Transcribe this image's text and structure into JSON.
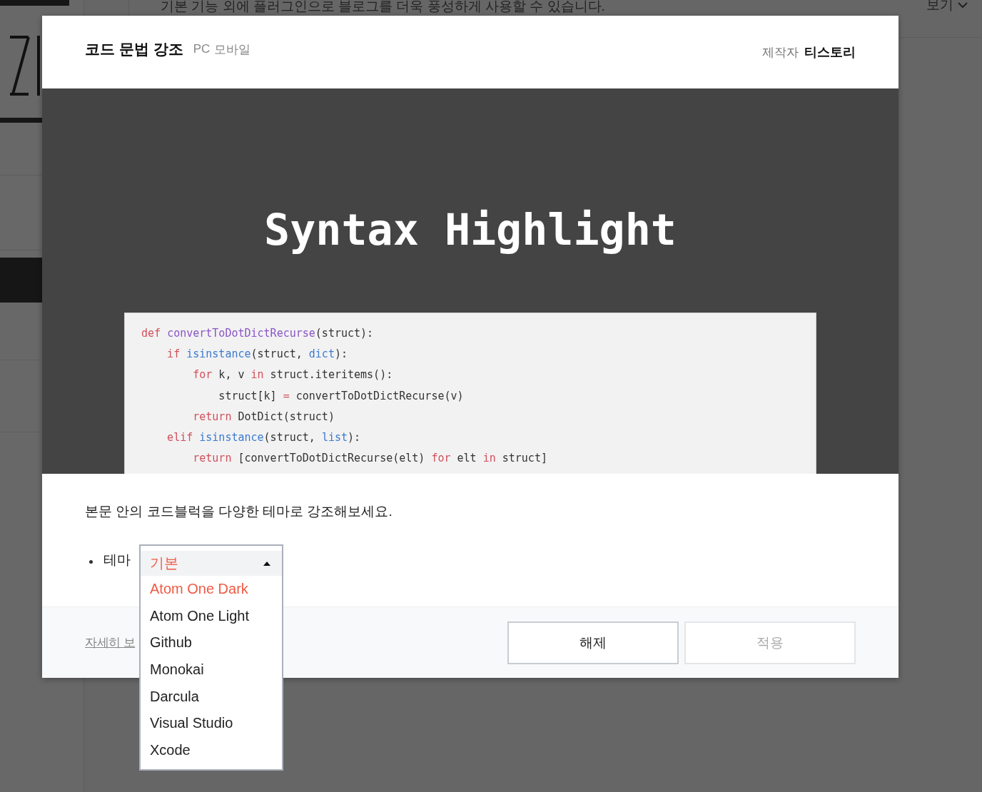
{
  "background_page": {
    "description": "기본 기능 외에 플러그인으로 블로그를 더욱 풍성하게 사용할 수 있습니다.",
    "view_menu": "보기"
  },
  "dialog": {
    "title": "코드 문법 강조",
    "platforms": [
      "PC",
      "모바일"
    ],
    "author_label": "제작자",
    "author": "티스토리",
    "preview": {
      "heading": "Syntax Highlight",
      "code_lines": [
        [
          {
            "text": "def ",
            "kind": "keyword"
          },
          {
            "text": "convertToDotDictRecurse",
            "kind": "function"
          },
          {
            "text": "(struct):",
            "kind": "plain"
          }
        ],
        [
          {
            "text": "    if ",
            "kind": "keyword"
          },
          {
            "text": "isinstance",
            "kind": "builtin"
          },
          {
            "text": "(struct, ",
            "kind": "plain"
          },
          {
            "text": "dict",
            "kind": "builtin"
          },
          {
            "text": "):",
            "kind": "plain"
          }
        ],
        [
          {
            "text": "        for",
            "kind": "keyword"
          },
          {
            "text": " k, v ",
            "kind": "plain"
          },
          {
            "text": "in",
            "kind": "keyword"
          },
          {
            "text": " struct.iteritems():",
            "kind": "plain"
          }
        ],
        [
          {
            "text": "            struct[k] ",
            "kind": "plain"
          },
          {
            "text": "=",
            "kind": "keyword"
          },
          {
            "text": " convertToDotDictRecurse(v)",
            "kind": "plain"
          }
        ],
        [
          {
            "text": "        return",
            "kind": "keyword"
          },
          {
            "text": " DotDict(struct)",
            "kind": "plain"
          }
        ],
        [
          {
            "text": "    elif ",
            "kind": "keyword"
          },
          {
            "text": "isinstance",
            "kind": "builtin"
          },
          {
            "text": "(struct, ",
            "kind": "plain"
          },
          {
            "text": "list",
            "kind": "builtin"
          },
          {
            "text": "):",
            "kind": "plain"
          }
        ],
        [
          {
            "text": "        return",
            "kind": "keyword"
          },
          {
            "text": " [convertToDotDictRecurse(elt) ",
            "kind": "plain"
          },
          {
            "text": "for",
            "kind": "keyword"
          },
          {
            "text": " elt ",
            "kind": "plain"
          },
          {
            "text": "in",
            "kind": "keyword"
          },
          {
            "text": " struct]",
            "kind": "plain"
          }
        ]
      ]
    },
    "description": "본문 안의 코드블럭을 다양한 테마로 강조해보세요.",
    "theme": {
      "label": "테마",
      "value": "기본",
      "expanded": true,
      "options": [
        {
          "label": "Atom One Dark",
          "selected": true
        },
        {
          "label": "Atom One Light",
          "selected": false
        },
        {
          "label": "Github",
          "selected": false
        },
        {
          "label": "Monokai",
          "selected": false
        },
        {
          "label": "Darcula",
          "selected": false
        },
        {
          "label": "Visual Studio",
          "selected": false
        },
        {
          "label": "Xcode",
          "selected": false
        }
      ]
    },
    "details_link": "자세히 보",
    "buttons": [
      {
        "label": "해제",
        "disabled": false
      },
      {
        "label": "적용",
        "disabled": true
      }
    ]
  }
}
